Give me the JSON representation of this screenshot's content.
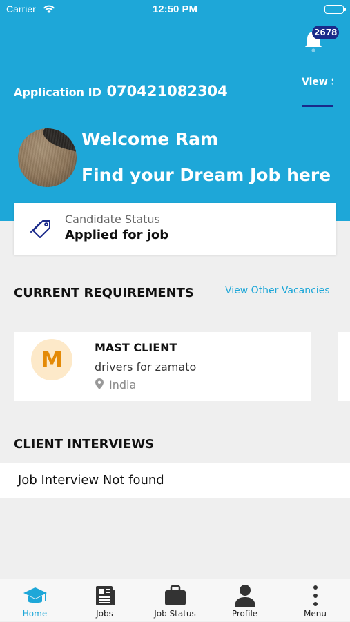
{
  "status_bar": {
    "carrier": "Carrier",
    "time": "12:50 PM"
  },
  "header": {
    "notification_count": "2678",
    "application_id_label": "Application ID",
    "application_id": "070421082304",
    "view_status_label": "View Status",
    "welcome": "Welcome Ram",
    "tagline": "Find your Dream Job here"
  },
  "candidate_status": {
    "label": "Candidate Status",
    "value": "Applied for job"
  },
  "requirements": {
    "title": "CURRENT REQUIREMENTS",
    "view_other_label": "View Other Vacancies",
    "jobs": [
      {
        "initial": "M",
        "client": "MAST CLIENT",
        "description": "drivers for zamato",
        "location": "India"
      }
    ]
  },
  "interviews": {
    "title": "CLIENT INTERVIEWS",
    "empty_message": "Job Interview Not found"
  },
  "tabs": [
    {
      "label": "Home",
      "icon": "graduation-cap-icon",
      "active": true
    },
    {
      "label": "Jobs",
      "icon": "newspaper-icon"
    },
    {
      "label": "Job Status",
      "icon": "briefcase-icon"
    },
    {
      "label": "Profile",
      "icon": "user-icon"
    },
    {
      "label": "Menu",
      "icon": "more-vertical-icon"
    }
  ],
  "colors": {
    "primary": "#1ea7d8",
    "badge": "#1a2a8a",
    "job_avatar_bg": "#fde9c9",
    "job_avatar_text": "#e48a07"
  }
}
